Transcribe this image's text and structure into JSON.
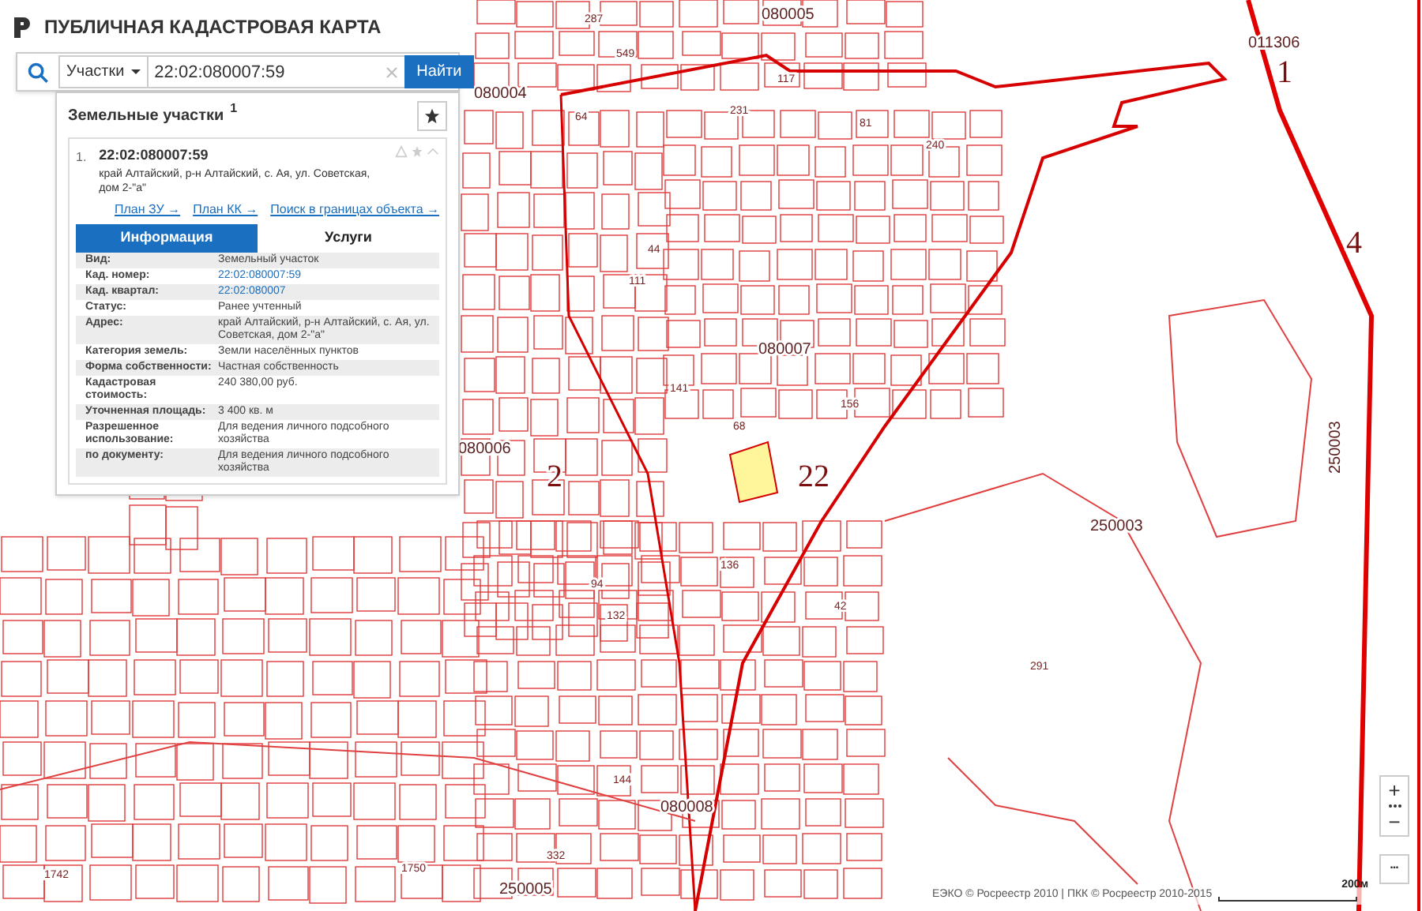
{
  "app": {
    "title": "ПУБЛИЧНАЯ КАДАСТРОВАЯ КАРТА"
  },
  "search": {
    "type_label": "Участки",
    "value": "22:02:080007:59",
    "button": "Найти"
  },
  "results": {
    "heading": "Земельные участки",
    "count": "1",
    "item": {
      "index": "1.",
      "number": "22:02:080007:59",
      "address": "край Алтайский, р-н Алтайский, с. Ая, ул. Советская, дом 2-\"а\"",
      "expanded": true,
      "links": [
        "План ЗУ →",
        "План КК →",
        "Поиск в границах объекта →"
      ],
      "tabs": [
        {
          "label": "Информация",
          "selected": true
        },
        {
          "label": "Услуги",
          "selected": false
        }
      ],
      "rows": [
        {
          "label": "Вид:",
          "value": "Земельный участок",
          "kind": "text"
        },
        {
          "label": "Кад. номер:",
          "value": "22:02:080007:59",
          "kind": "link"
        },
        {
          "label": "Кад. квартал:",
          "value": "22:02:080007",
          "kind": "link"
        },
        {
          "label": "Статус:",
          "value": "Ранее учтенный",
          "kind": "text"
        },
        {
          "label": "Адрес:",
          "value": "край Алтайский, р-н Алтайский, с. Ая, ул. Советская, дом 2-\"а\"",
          "kind": "text"
        },
        {
          "label": "Категория земель:",
          "value": "Земли населённых пунктов",
          "kind": "text"
        },
        {
          "label": "Форма собственности:",
          "value": "Частная собственность",
          "kind": "text"
        },
        {
          "label": "Кадастровая стоимость:",
          "value": "240 380,00 руб.",
          "kind": "text"
        },
        {
          "label": "Уточненная площадь:",
          "value": "3 400 кв. м",
          "kind": "text"
        },
        {
          "label": "Разрешенное использование:",
          "value": "Для ведения личного подсобного хозяйства",
          "kind": "text"
        },
        {
          "label": "по документу:",
          "value": "Для ведения личного подсобного хозяйства",
          "kind": "text"
        }
      ]
    }
  },
  "map": {
    "labels": [
      {
        "text": "011306",
        "kind": "block"
      },
      {
        "text": "1",
        "kind": "district"
      },
      {
        "text": "4",
        "kind": "district"
      },
      {
        "text": "080004",
        "kind": "block"
      },
      {
        "text": "080005",
        "kind": "block"
      },
      {
        "text": "080007",
        "kind": "block"
      },
      {
        "text": "080006",
        "kind": "block"
      },
      {
        "text": "080008",
        "kind": "block"
      },
      {
        "text": "22",
        "kind": "district"
      },
      {
        "text": "2",
        "kind": "district"
      },
      {
        "text": "250003",
        "kind": "block"
      },
      {
        "text": "250003",
        "kind": "block"
      },
      {
        "text": "250005",
        "kind": "block"
      },
      {
        "text": "291",
        "kind": "parcel"
      },
      {
        "text": "156",
        "kind": "parcel"
      },
      {
        "text": "136",
        "kind": "parcel"
      },
      {
        "text": "42",
        "kind": "parcel"
      },
      {
        "text": "1742",
        "kind": "parcel"
      },
      {
        "text": "1750",
        "kind": "parcel"
      },
      {
        "text": "44",
        "kind": "parcel"
      },
      {
        "text": "287",
        "kind": "parcel"
      },
      {
        "text": "549",
        "kind": "parcel"
      },
      {
        "text": "64",
        "kind": "parcel"
      },
      {
        "text": "117",
        "kind": "parcel"
      },
      {
        "text": "231",
        "kind": "parcel"
      },
      {
        "text": "240",
        "kind": "parcel"
      },
      {
        "text": "81",
        "kind": "parcel"
      },
      {
        "text": "68",
        "kind": "parcel"
      },
      {
        "text": "141",
        "kind": "parcel"
      },
      {
        "text": "132",
        "kind": "parcel"
      },
      {
        "text": "94",
        "kind": "parcel"
      },
      {
        "text": "144",
        "kind": "parcel"
      },
      {
        "text": "332",
        "kind": "parcel"
      },
      {
        "text": "111",
        "kind": "parcel"
      }
    ]
  },
  "controls": {
    "zoom_in": "+",
    "zoom_out": "−",
    "more": "•••"
  },
  "scale": "200м",
  "attribution": "ЕЭКО © Росреестр 2010 | ПКК © Росреестр 2010-2015"
}
